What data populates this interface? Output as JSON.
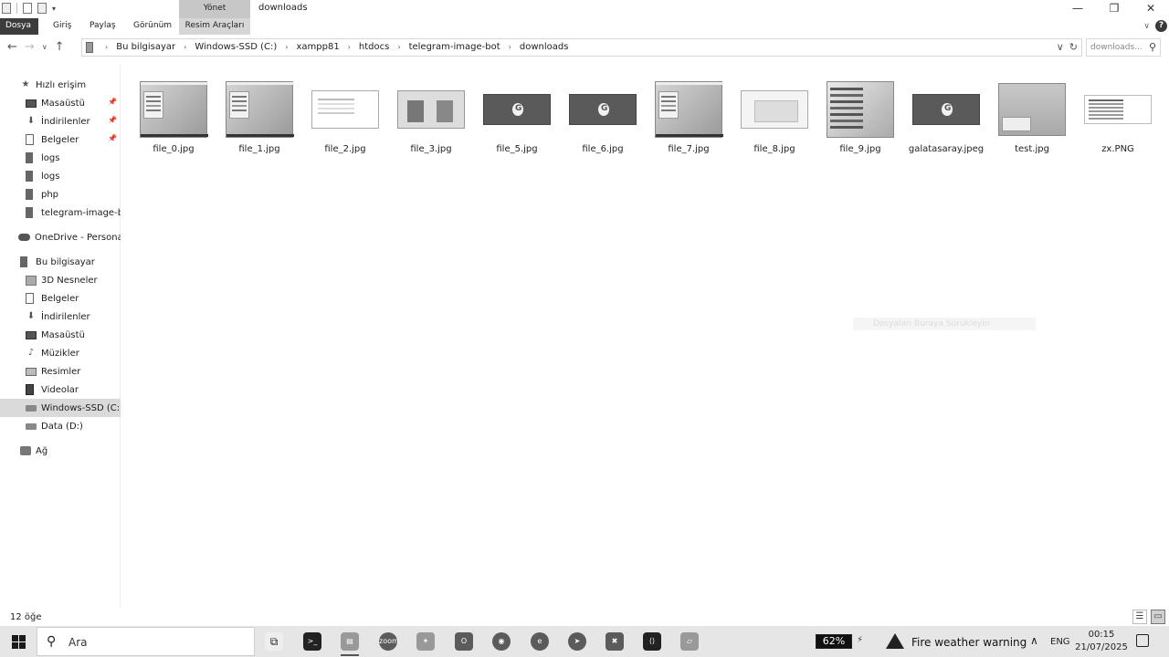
{
  "titlebar": {
    "contextual_group": "Yönet",
    "title": "downloads",
    "minimize": "—",
    "restore": "❐",
    "close": "✕"
  },
  "ribbon": {
    "tabs": [
      "Dosya",
      "Giriş",
      "Paylaş",
      "Görünüm",
      "Resim Araçları"
    ],
    "help": "?"
  },
  "navigation": {
    "breadcrumbs": [
      "Bu bilgisayar",
      "Windows-SSD (C:)",
      "xampp81",
      "htdocs",
      "telegram-image-bot",
      "downloads"
    ],
    "search_placeholder": "downloads..."
  },
  "sidebar": {
    "quick_access": {
      "label": "Hızlı erişim",
      "items": [
        "Masaüstü",
        "İndirilenler",
        "Belgeler",
        "logs",
        "logs",
        "php",
        "telegram-image-bo"
      ]
    },
    "onedrive": "OneDrive - Personal",
    "this_pc": {
      "label": "Bu bilgisayar",
      "items": [
        "3D Nesneler",
        "Belgeler",
        "İndirilenler",
        "Masaüstü",
        "Müzikler",
        "Resimler",
        "Videolar",
        "Windows-SSD (C:)",
        "Data (D:)"
      ]
    },
    "network": "Ağ"
  },
  "files": [
    {
      "name": "file_0.jpg",
      "thumb": "desktop"
    },
    {
      "name": "file_1.jpg",
      "thumb": "desktop"
    },
    {
      "name": "file_2.jpg",
      "thumb": "page"
    },
    {
      "name": "file_3.jpg",
      "thumb": "photo"
    },
    {
      "name": "file_5.jpg",
      "thumb": "galatasaray"
    },
    {
      "name": "file_6.jpg",
      "thumb": "galatasaray"
    },
    {
      "name": "file_7.jpg",
      "thumb": "desktop"
    },
    {
      "name": "file_8.jpg",
      "thumb": "document"
    },
    {
      "name": "file_9.jpg",
      "thumb": "list"
    },
    {
      "name": "galatasaray.jpeg",
      "thumb": "galatasaray"
    },
    {
      "name": "test.jpg",
      "thumb": "grey"
    },
    {
      "name": "zx.PNG",
      "thumb": "png"
    }
  ],
  "overlay_text": "Dosyaları Buraya Sürükleyin",
  "status": {
    "item_count": "12 öğe"
  },
  "taskbar": {
    "search_placeholder": "Ara",
    "battery": "62%",
    "weather_warning": "Fire weather warning",
    "language": "ENG",
    "time": "00:15",
    "date": "21/07/2025",
    "icons": [
      "task-view-icon",
      "terminal-icon",
      "file-explorer-icon",
      "zoom-icon",
      "app-icon",
      "outlook-icon",
      "chrome-icon",
      "edge-icon",
      "telegram-icon",
      "xampp-icon",
      "vscode-icon",
      "app-icon"
    ]
  }
}
